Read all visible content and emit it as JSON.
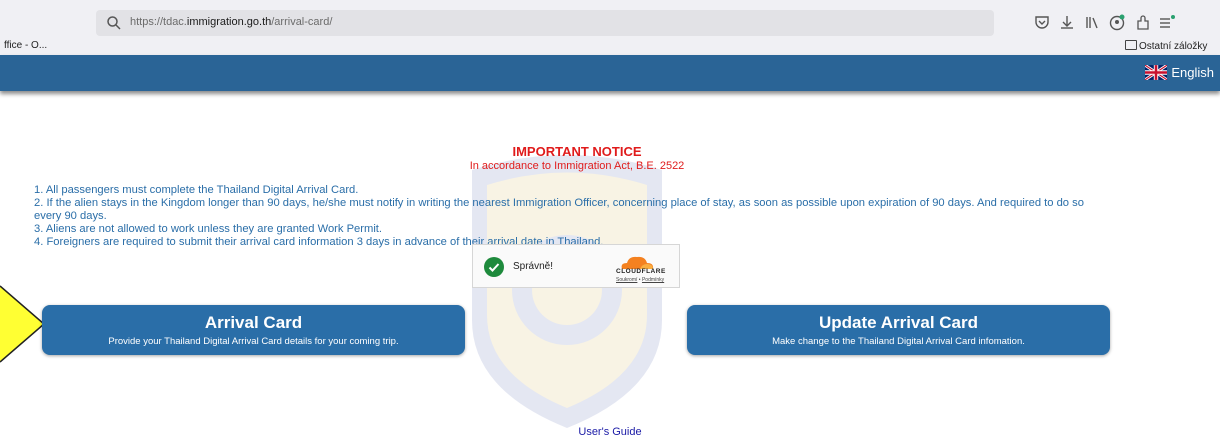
{
  "browser": {
    "url_prefix": "https://tdac.",
    "url_domain": "immigration.go.th",
    "url_path": "/arrival-card/",
    "bookmark_left": "ffice - O...",
    "bookmark_right": "Ostatní záložky",
    "icons": [
      "search-icon",
      "pocket-icon",
      "download-icon",
      "library-icon",
      "account-icon",
      "extensions-icon",
      "menu-icon"
    ]
  },
  "header": {
    "language": "English",
    "flag": "uk-flag-icon",
    "bar_color": "#2a6496"
  },
  "notice": {
    "title": "IMPORTANT NOTICE",
    "subtitle": "In accordance to Immigration Act, B.E. 2522",
    "rules": [
      "1. All passengers must complete the Thailand Digital Arrival Card.",
      "2. If the alien stays in the Kingdom longer than 90 days, he/she must notify in writing the nearest Immigration Officer, concerning place of stay, as soon as possible upon expiration of 90 days. And required to do so every 90 days.",
      "3. Aliens are not allowed to work unless they are granted Work Permit.",
      "4. Foreigners are required to submit their arrival card information 3 days in advance of their arrival date in Thailand."
    ]
  },
  "captcha": {
    "status": "Správně!",
    "brand": "CLOUDFLARE",
    "privacy": "Soukromí",
    "separator": "•",
    "terms": "Podmínky"
  },
  "actions": {
    "arrival": {
      "title": "Arrival Card",
      "desc": "Provide your Thailand Digital Arrival Card details for your coming trip."
    },
    "update": {
      "title": "Update Arrival Card",
      "desc": "Make change to the Thailand Digital Arrival Card infomation."
    }
  },
  "footer": {
    "guide": "User's Guide"
  },
  "colors": {
    "accent": "#2a6ea8",
    "notice": "#e01b1b",
    "arrow_fill": "#ffff33"
  }
}
